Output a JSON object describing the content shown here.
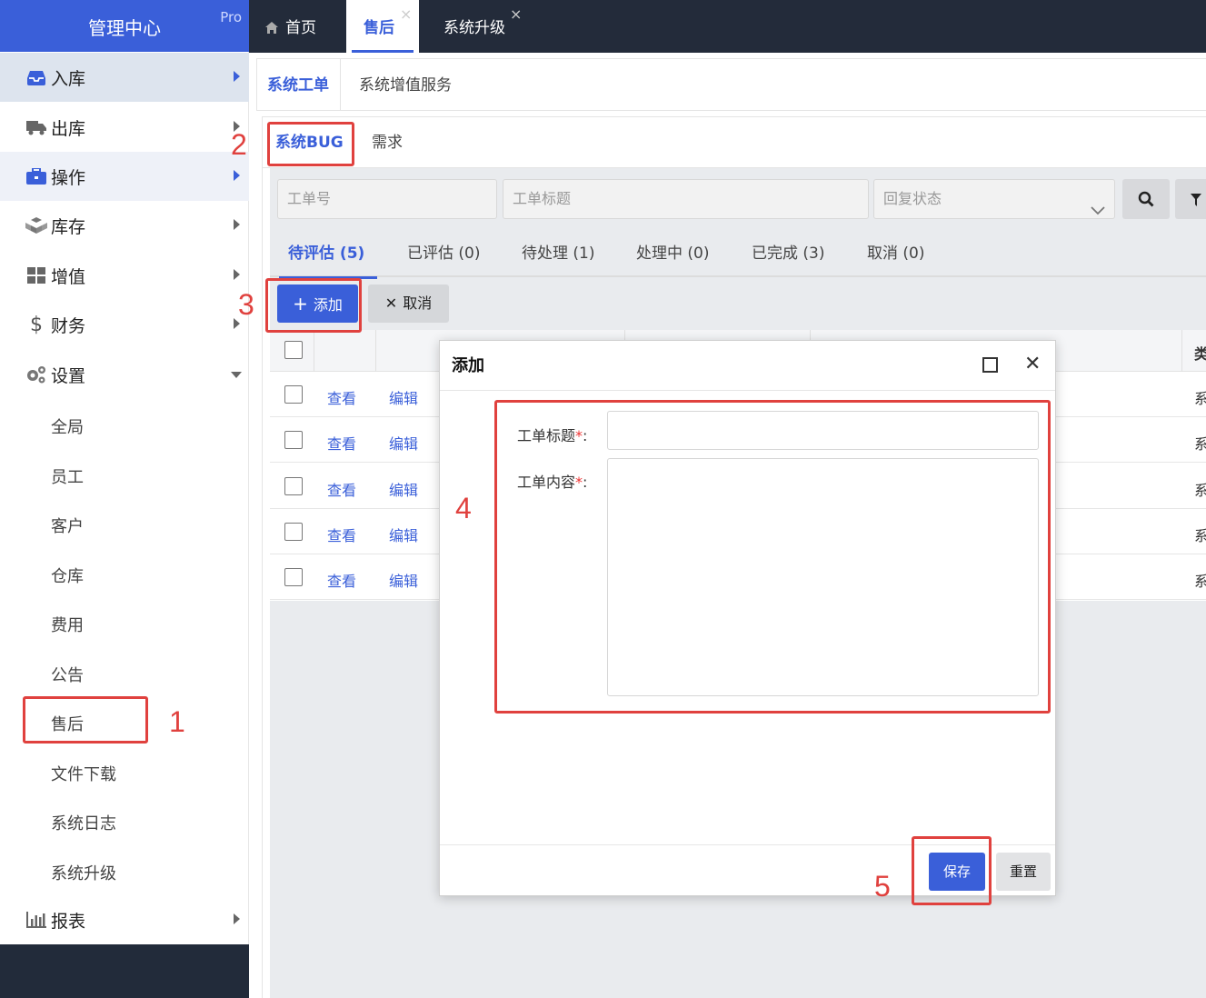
{
  "sidebar": {
    "brand": "管理中心",
    "badge": "Pro",
    "items": [
      {
        "label": "入库",
        "icon": "inbox-icon"
      },
      {
        "label": "出库",
        "icon": "truck-icon"
      },
      {
        "label": "操作",
        "icon": "briefcase-icon"
      },
      {
        "label": "库存",
        "icon": "cubes-icon"
      },
      {
        "label": "增值",
        "icon": "grid-icon"
      },
      {
        "label": "财务",
        "icon": "dollar-icon"
      },
      {
        "label": "设置",
        "icon": "gears-icon"
      },
      {
        "label": "报表",
        "icon": "bar-chart-icon"
      }
    ],
    "subitems": [
      "全局",
      "员工",
      "客户",
      "仓库",
      "费用",
      "公告",
      "售后",
      "文件下载",
      "系统日志",
      "系统升级"
    ]
  },
  "topbar": {
    "tabs": [
      {
        "label": "首页",
        "icon": "home-icon"
      },
      {
        "label": "售后"
      },
      {
        "label": "系统升级"
      }
    ],
    "close_glyph": "×"
  },
  "content": {
    "tabs": [
      "系统工单",
      "系统增值服务"
    ],
    "subtabs": [
      "系统BUG",
      "需求"
    ],
    "filters": {
      "ticket_no": "工单号",
      "ticket_title": "工单标题",
      "reply_status": "回复状态"
    },
    "status_tabs": [
      "待评估 (5)",
      "已评估 (0)",
      "待处理 (1)",
      "处理中 (0)",
      "已完成 (3)",
      "取消 (0)"
    ],
    "buttons": {
      "add": "添加",
      "add_glyph": "+",
      "cancel": "取消",
      "cancel_glyph": "✕"
    },
    "table": {
      "header_cut": "类",
      "rows": [
        {
          "view": "查看",
          "edit": "编辑",
          "cut": "系"
        },
        {
          "view": "查看",
          "edit": "编辑",
          "cut": "系"
        },
        {
          "view": "查看",
          "edit": "编辑",
          "cut": "系"
        },
        {
          "view": "查看",
          "edit": "编辑",
          "cut": "系"
        },
        {
          "view": "查看",
          "edit": "编辑",
          "cut": "系"
        }
      ]
    }
  },
  "dialog": {
    "title": "添加",
    "close_glyph": "✕",
    "fields": {
      "title_label": "工单标题",
      "content_label": "工单内容",
      "required_mark": "*",
      "colon": ":"
    },
    "buttons": {
      "save": "保存",
      "reset": "重置"
    }
  },
  "annotations": [
    "1",
    "2",
    "3",
    "4",
    "5"
  ],
  "colors": {
    "accent": "#3a5fd9",
    "annotation": "#e0413e",
    "topbar": "#232b3a"
  }
}
